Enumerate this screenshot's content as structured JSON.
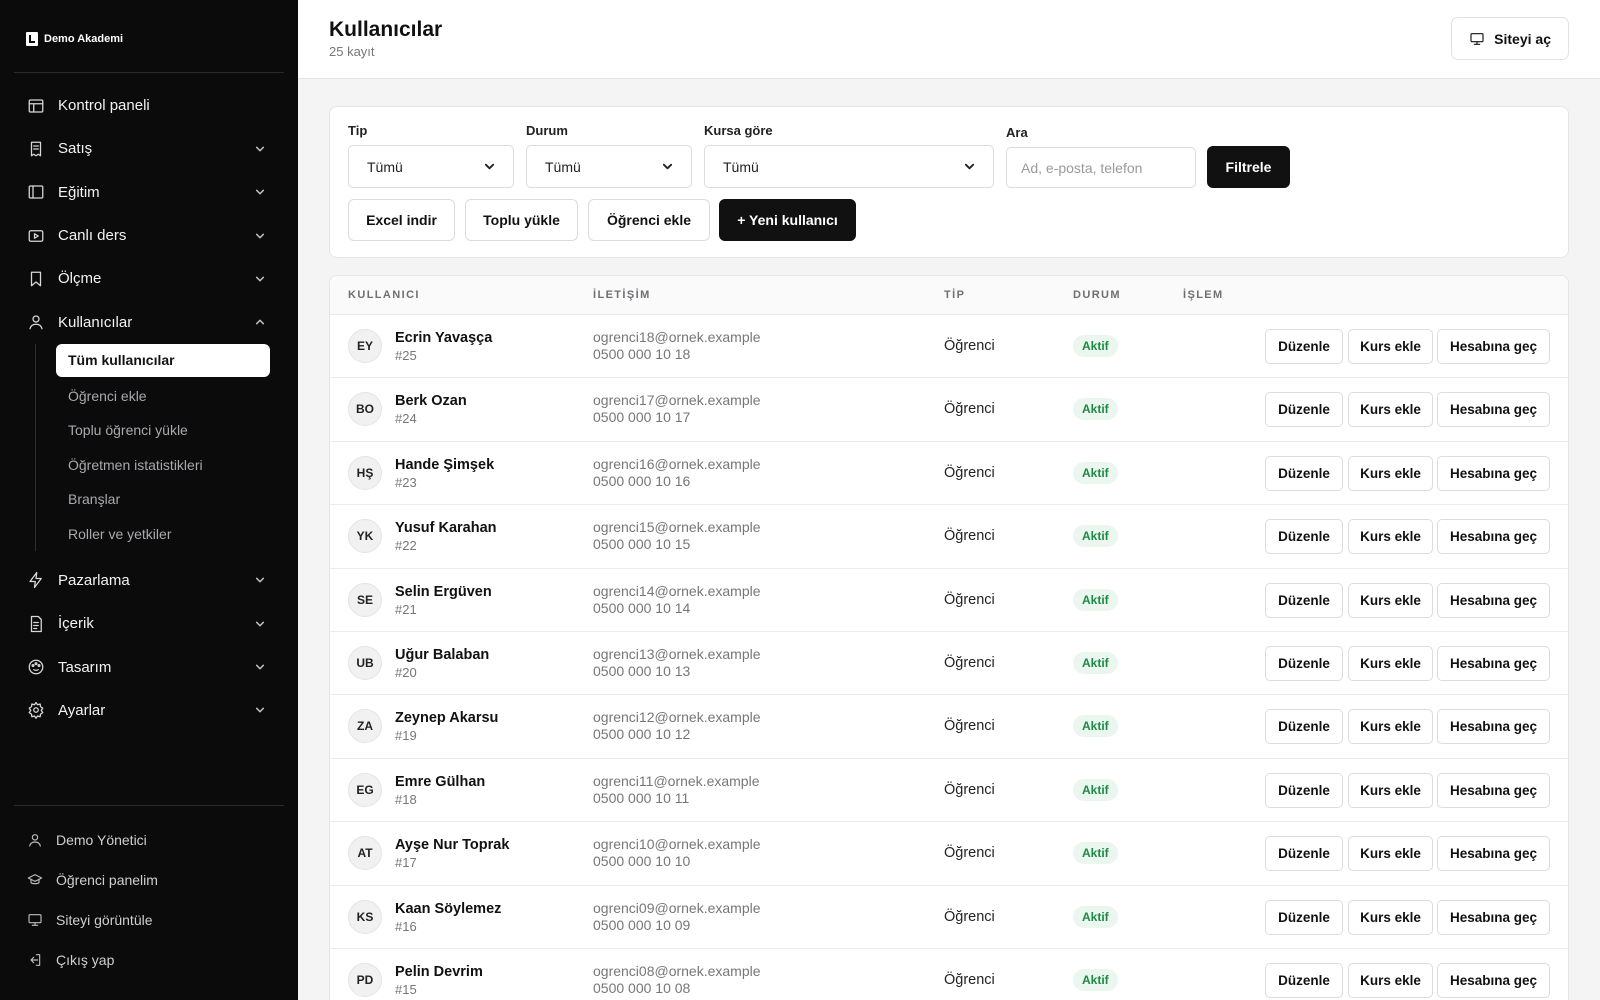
{
  "brand": {
    "name": "Demo Akademi"
  },
  "sidebar": {
    "items": [
      {
        "key": "dashboard",
        "label": "Kontrol paneli",
        "icon": "layout-icon",
        "chevron": false
      },
      {
        "key": "sales",
        "label": "Satış",
        "icon": "receipt-icon",
        "chevron": true
      },
      {
        "key": "education",
        "label": "Eğitim",
        "icon": "book-panel-icon",
        "chevron": true
      },
      {
        "key": "live",
        "label": "Canlı ders",
        "icon": "video-icon",
        "chevron": true
      },
      {
        "key": "measure",
        "label": "Ölçme",
        "icon": "bookmark-icon",
        "chevron": true
      },
      {
        "key": "users",
        "label": "Kullanıcılar",
        "icon": "user-icon",
        "chevron": true,
        "expanded": true
      }
    ],
    "users_sub": [
      {
        "label": "Tüm kullanıcılar",
        "active": true
      },
      {
        "label": "Öğrenci ekle",
        "active": false
      },
      {
        "label": "Toplu öğrenci yükle",
        "active": false
      },
      {
        "label": "Öğretmen istatistikleri",
        "active": false
      },
      {
        "label": "Branşlar",
        "active": false
      },
      {
        "label": "Roller ve yetkiler",
        "active": false
      }
    ],
    "items_after": [
      {
        "key": "marketing",
        "label": "Pazarlama",
        "icon": "bolt-icon",
        "chevron": true
      },
      {
        "key": "content",
        "label": "İçerik",
        "icon": "document-icon",
        "chevron": true
      },
      {
        "key": "design",
        "label": "Tasarım",
        "icon": "palette-icon",
        "chevron": true
      },
      {
        "key": "settings",
        "label": "Ayarlar",
        "icon": "gear-icon",
        "chevron": true
      }
    ],
    "bottom": [
      {
        "label": "Demo Yönetici",
        "icon": "user-icon"
      },
      {
        "label": "Öğrenci panelim",
        "icon": "graduation-cap-icon"
      },
      {
        "label": "Siteyi görüntüle",
        "icon": "monitor-icon"
      },
      {
        "label": "Çıkış yap",
        "icon": "logout-icon"
      }
    ]
  },
  "header": {
    "title": "Kullanıcılar",
    "subtitle": "25 kayıt",
    "site_button": "Siteyi aç"
  },
  "filters": {
    "type": {
      "label": "Tip",
      "value": "Tümü"
    },
    "status": {
      "label": "Durum",
      "value": "Tümü"
    },
    "course": {
      "label": "Kursa göre",
      "value": "Tümü"
    },
    "search": {
      "label": "Ara",
      "placeholder": "Ad, e-posta, telefon"
    },
    "filter_button": "Filtrele",
    "actions": {
      "excel": "Excel indir",
      "bulk": "Toplu yükle",
      "add_student": "Öğrenci ekle",
      "new_user": "+ Yeni kullanıcı"
    }
  },
  "table": {
    "columns": {
      "user": "KULLANICI",
      "contact": "İLETİŞİM",
      "type": "TİP",
      "status": "DURUM",
      "action": "İŞLEM"
    },
    "row_actions": {
      "edit": "Düzenle",
      "add_course": "Kurs ekle",
      "impersonate": "Hesabına geç"
    },
    "rows": [
      {
        "initials": "EY",
        "name": "Ecrin Yavaşça",
        "id": "#25",
        "email": "ogrenci18@ornek.example",
        "phone": "0500 000 10 18",
        "type": "Öğrenci",
        "status": "Aktif"
      },
      {
        "initials": "BO",
        "name": "Berk Ozan",
        "id": "#24",
        "email": "ogrenci17@ornek.example",
        "phone": "0500 000 10 17",
        "type": "Öğrenci",
        "status": "Aktif"
      },
      {
        "initials": "HŞ",
        "name": "Hande Şimşek",
        "id": "#23",
        "email": "ogrenci16@ornek.example",
        "phone": "0500 000 10 16",
        "type": "Öğrenci",
        "status": "Aktif"
      },
      {
        "initials": "YK",
        "name": "Yusuf Karahan",
        "id": "#22",
        "email": "ogrenci15@ornek.example",
        "phone": "0500 000 10 15",
        "type": "Öğrenci",
        "status": "Aktif"
      },
      {
        "initials": "SE",
        "name": "Selin Ergüven",
        "id": "#21",
        "email": "ogrenci14@ornek.example",
        "phone": "0500 000 10 14",
        "type": "Öğrenci",
        "status": "Aktif"
      },
      {
        "initials": "UB",
        "name": "Uğur Balaban",
        "id": "#20",
        "email": "ogrenci13@ornek.example",
        "phone": "0500 000 10 13",
        "type": "Öğrenci",
        "status": "Aktif"
      },
      {
        "initials": "ZA",
        "name": "Zeynep Akarsu",
        "id": "#19",
        "email": "ogrenci12@ornek.example",
        "phone": "0500 000 10 12",
        "type": "Öğrenci",
        "status": "Aktif"
      },
      {
        "initials": "EG",
        "name": "Emre Gülhan",
        "id": "#18",
        "email": "ogrenci11@ornek.example",
        "phone": "0500 000 10 11",
        "type": "Öğrenci",
        "status": "Aktif"
      },
      {
        "initials": "AT",
        "name": "Ayşe Nur Toprak",
        "id": "#17",
        "email": "ogrenci10@ornek.example",
        "phone": "0500 000 10 10",
        "type": "Öğrenci",
        "status": "Aktif"
      },
      {
        "initials": "KS",
        "name": "Kaan Söylemez",
        "id": "#16",
        "email": "ogrenci09@ornek.example",
        "phone": "0500 000 10 09",
        "type": "Öğrenci",
        "status": "Aktif"
      },
      {
        "initials": "PD",
        "name": "Pelin Devrim",
        "id": "#15",
        "email": "ogrenci08@ornek.example",
        "phone": "0500 000 10 08",
        "type": "Öğrenci",
        "status": "Aktif"
      }
    ]
  },
  "colors": {
    "sidebar_bg": "#0b0b0c",
    "accent": "#111111",
    "badge_bg": "#eaf6ee",
    "badge_text": "#1d8a45"
  }
}
